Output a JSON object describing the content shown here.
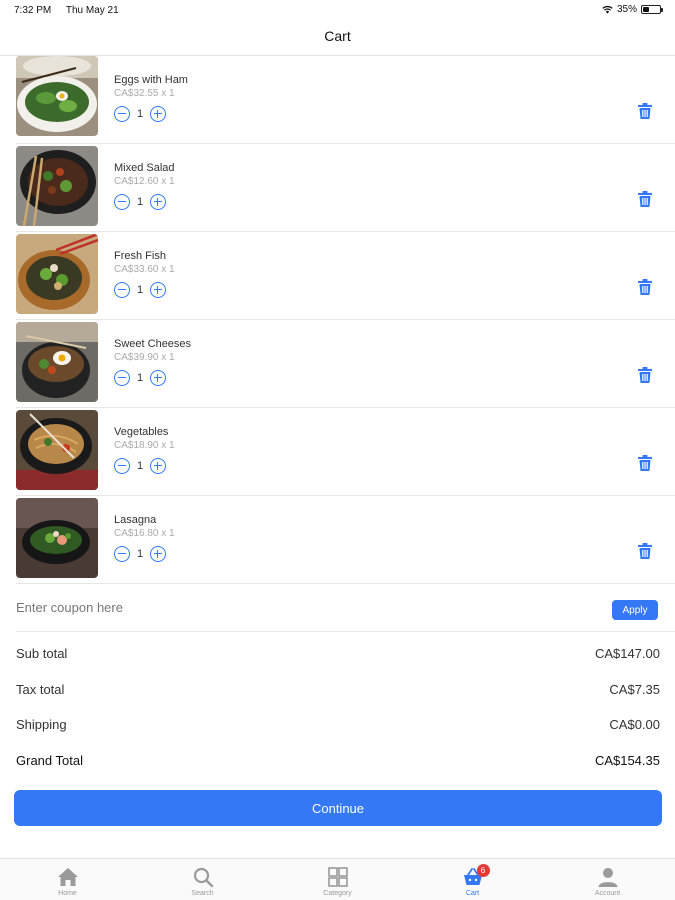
{
  "status_bar": {
    "time": "7:32 PM",
    "date": "Thu May 21",
    "battery": "35%",
    "battery_level": 0.35
  },
  "nav": {
    "title": "Cart"
  },
  "cart": {
    "items": [
      {
        "name": "Eggs with Ham",
        "price": "CA$32.55 x 1",
        "quantity": "1",
        "image": "bowl-of-greens-with-egg"
      },
      {
        "name": "Mixed Salad",
        "price": "CA$12.60 x 1",
        "quantity": "1",
        "image": "skillet-of-stir-fry"
      },
      {
        "name": "Fresh Fish",
        "price": "CA$33.60 x 1",
        "quantity": "1",
        "image": "bowl-with-chopsticks"
      },
      {
        "name": "Sweet Cheeses",
        "price": "CA$39.90 x 1",
        "quantity": "1",
        "image": "stone-pot-bibimbap"
      },
      {
        "name": "Vegetables",
        "price": "CA$18.90 x 1",
        "quantity": "1",
        "image": "noodles-with-chopsticks"
      },
      {
        "name": "Lasagna",
        "price": "CA$16.80 x 1",
        "quantity": "1",
        "image": "dark-bowl-salad"
      }
    ]
  },
  "coupon": {
    "placeholder": "Enter coupon here",
    "apply_label": "Apply"
  },
  "totals": {
    "sub_total_label": "Sub total",
    "sub_total": "CA$147.00",
    "tax_label": "Tax total",
    "tax": "CA$7.35",
    "shipping_label": "Shipping",
    "shipping": "CA$0.00",
    "grand_label": "Grand Total",
    "grand": "CA$154.35"
  },
  "continue_label": "Continue",
  "tabs": [
    {
      "label": "Home",
      "icon": "home-icon"
    },
    {
      "label": "Search",
      "icon": "search-icon"
    },
    {
      "label": "Category",
      "icon": "grid-icon"
    },
    {
      "label": "Cart",
      "icon": "basket-icon",
      "badge": "6",
      "active": true
    },
    {
      "label": "Account",
      "icon": "person-icon"
    }
  ],
  "colors": {
    "accent": "#3478f6",
    "badge": "#e53935",
    "divider": "#e6e6e6"
  }
}
